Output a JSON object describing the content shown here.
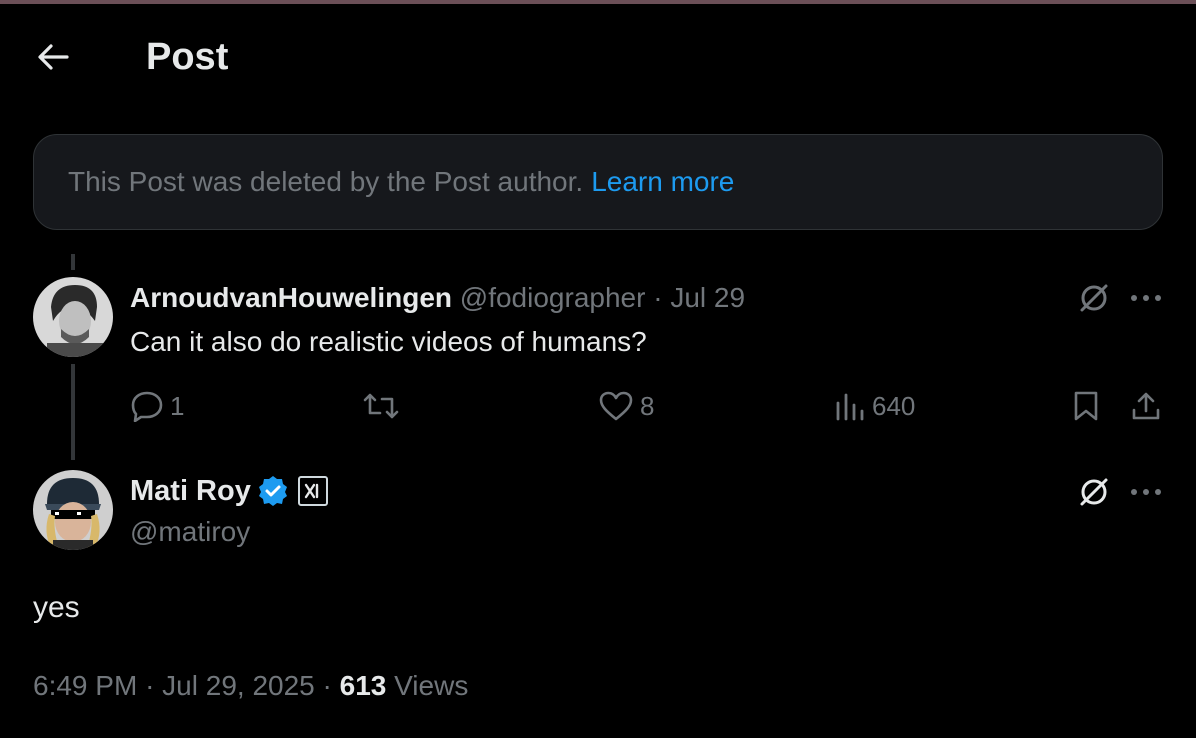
{
  "header": {
    "title": "Post"
  },
  "notice": {
    "text": "This Post was deleted by the Post author.",
    "link": "Learn more"
  },
  "reply": {
    "name": "ArnoudvanHouwelingen",
    "handle": "@fodiographer",
    "date": "Jul 29",
    "text": "Can it also do realistic videos of  humans?",
    "stats": {
      "replies": "1",
      "likes": "8",
      "views": "640"
    }
  },
  "main": {
    "name": "Mati Roy",
    "handle": "@matiroy",
    "text": "yes",
    "time": "6:49 PM",
    "date": "Jul 29, 2025",
    "views_count": "613",
    "views_label": "Views"
  },
  "colors": {
    "accent": "#1d9bf0",
    "muted": "#71767b",
    "background": "#000000",
    "text": "#e7e9ea"
  }
}
